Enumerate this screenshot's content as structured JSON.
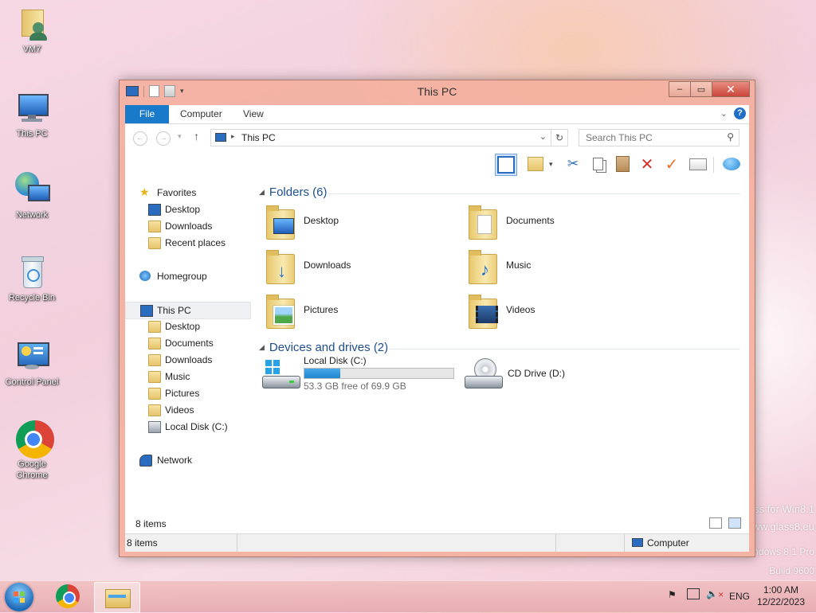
{
  "desktop": {
    "icons": [
      {
        "label": "VM7",
        "icon": "user-folder-icon"
      },
      {
        "label": "This PC",
        "icon": "computer-icon"
      },
      {
        "label": "Network",
        "icon": "network-globe-icon"
      },
      {
        "label": "Recycle Bin",
        "icon": "recycle-bin-icon"
      },
      {
        "label": "Control Panel",
        "icon": "control-panel-icon"
      },
      {
        "label": "Google Chrome",
        "icon": "chrome-icon"
      }
    ],
    "watermark": [
      "ss for Win8.1",
      "www.glass8.eu",
      "Windows 8.1 Pro",
      "Build 9600"
    ]
  },
  "window": {
    "title": "This PC",
    "tabs": [
      "File",
      "Computer",
      "View"
    ],
    "address": "This PC",
    "search_placeholder": "Search This PC",
    "nav": {
      "favorites_label": "Favorites",
      "favorites": [
        "Desktop",
        "Downloads",
        "Recent places"
      ],
      "homegroup": "Homegroup",
      "thispc": "This PC",
      "thispc_children": [
        "Desktop",
        "Documents",
        "Downloads",
        "Music",
        "Pictures",
        "Videos",
        "Local Disk (C:)"
      ],
      "network": "Network"
    },
    "folders_group": "Folders (6)",
    "folders": [
      "Desktop",
      "Documents",
      "Downloads",
      "Music",
      "Pictures",
      "Videos"
    ],
    "devices_group": "Devices and drives (2)",
    "drives": [
      {
        "name": "Local Disk (C:)",
        "free": "53.3 GB free of 69.9 GB",
        "used_fraction": 0.24
      },
      {
        "name": "CD Drive (D:)"
      }
    ],
    "status_count": "8 items",
    "bottom_count": "8 items",
    "bottom_location": "Computer"
  },
  "taskbar": {
    "lang": "ENG",
    "time": "1:00 AM",
    "date": "12/22/2023"
  },
  "colors": {
    "accent": "#1979ca",
    "group_heading": "#1e4e8c",
    "drive_bar": "#2286d0"
  }
}
